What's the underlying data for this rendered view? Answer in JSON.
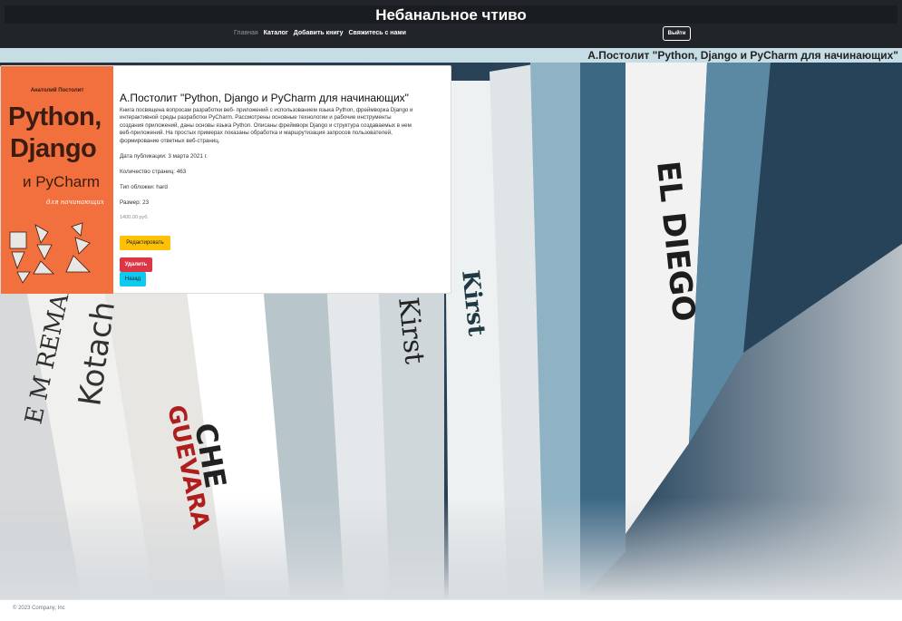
{
  "header": {
    "site_title": "Небанальное чтиво",
    "nav": [
      {
        "label": "Главная",
        "active": false
      },
      {
        "label": "Каталог",
        "active": true
      },
      {
        "label": "Добавить книгу",
        "active": true
      },
      {
        "label": "Свяжитесь с нами",
        "active": true
      }
    ],
    "logout_label": "Выйти"
  },
  "page_heading": "А.Постолит \"Python, Django и PyCharm для начинающих\"",
  "book": {
    "title": "А.Постолит \"Python, Django и PyCharm для начинающих\"",
    "description": "Книга посвящена вопросам разработки веб- приложений с использованием языка Python, фреймворка Django и интерактивной среды разработки PyCharm. Рассмотрены основные технологии и рабочие инструменты создания приложений, даны основы языка Python. Описаны фреймворк Django и структура создаваемых в нем веб-приложений. На простых примерах показаны обработка и маршрутизация запросов пользователей, формирование ответных веб-страниц.",
    "publication_date": "Дата публикации: 3 марта 2021 г.",
    "pages": "Количество страниц: 463",
    "cover_type": "Тип обложки: hard",
    "size": "Размер: 23",
    "price": "1400.00 руб.",
    "cover": {
      "author": "Анатолий Постолит",
      "line1": "Python,",
      "line2": "Django",
      "line3": "и PyCharm",
      "line4": "для начинающих"
    }
  },
  "buttons": {
    "edit": "Редактировать",
    "delete": "Удалить",
    "back": "Назад"
  },
  "colors": {
    "header_bg": "#212529",
    "strip_bg": "#c6dde6",
    "cover_bg": "#f26f3e",
    "edit": "#ffc107",
    "delete": "#dc3545",
    "back": "#0dcaf0"
  },
  "footer": {
    "text": "© 2023 Company, Inc"
  }
}
